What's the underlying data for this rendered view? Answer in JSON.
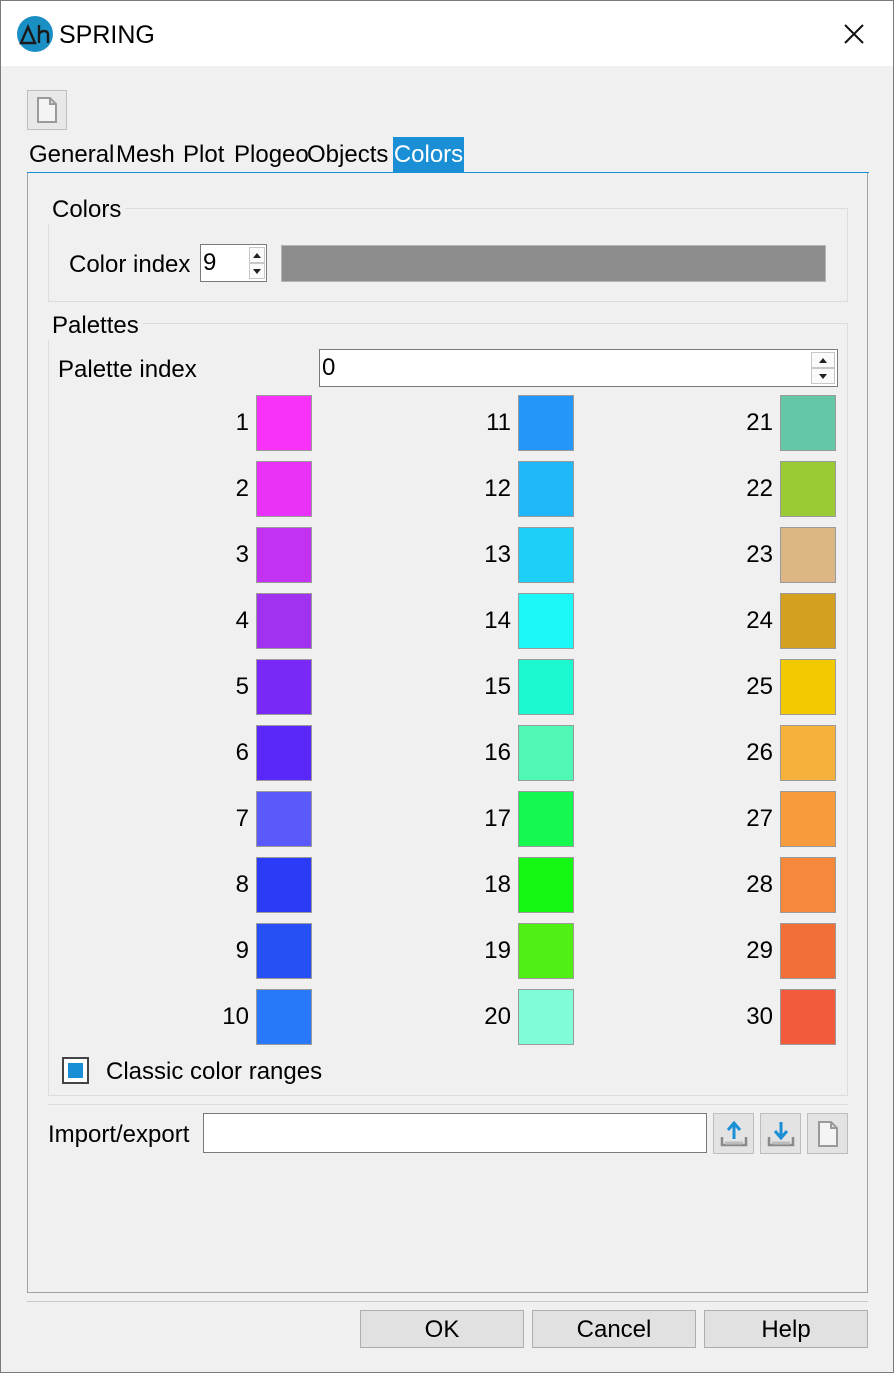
{
  "window": {
    "title": "SPRING",
    "logo_text": "Δh"
  },
  "tabs": [
    {
      "label": "General"
    },
    {
      "label": "Mesh"
    },
    {
      "label": "Plot"
    },
    {
      "label": "Plogeo"
    },
    {
      "label": "Objects"
    },
    {
      "label": "Colors",
      "active": true
    }
  ],
  "colors_group": {
    "title": "Colors",
    "color_index_label": "Color index",
    "color_index_value": "9",
    "preview_color": "#8c8c8c"
  },
  "palettes_group": {
    "title": "Palettes",
    "palette_index_label": "Palette index",
    "palette_index_value": "0",
    "swatches": [
      {
        "n": "1",
        "color": "#f832f8"
      },
      {
        "n": "2",
        "color": "#e832f8"
      },
      {
        "n": "3",
        "color": "#c232f0"
      },
      {
        "n": "4",
        "color": "#a032f0"
      },
      {
        "n": "5",
        "color": "#7a28f8"
      },
      {
        "n": "6",
        "color": "#5a28fa"
      },
      {
        "n": "7",
        "color": "#5a5afa"
      },
      {
        "n": "8",
        "color": "#2a3cf8"
      },
      {
        "n": "9",
        "color": "#2650f6"
      },
      {
        "n": "10",
        "color": "#2878fa"
      },
      {
        "n": "11",
        "color": "#2496fa"
      },
      {
        "n": "12",
        "color": "#20b8f8"
      },
      {
        "n": "13",
        "color": "#1ed0f8"
      },
      {
        "n": "14",
        "color": "#1cf8f8"
      },
      {
        "n": "15",
        "color": "#1cf8d0"
      },
      {
        "n": "16",
        "color": "#50f8b6"
      },
      {
        "n": "17",
        "color": "#14f850"
      },
      {
        "n": "18",
        "color": "#14f814"
      },
      {
        "n": "19",
        "color": "#50f014"
      },
      {
        "n": "20",
        "color": "#80fcd8"
      },
      {
        "n": "21",
        "color": "#64c8a8"
      },
      {
        "n": "22",
        "color": "#9acb34"
      },
      {
        "n": "23",
        "color": "#ddb686"
      },
      {
        "n": "24",
        "color": "#d4a020"
      },
      {
        "n": "25",
        "color": "#f2c800"
      },
      {
        "n": "26",
        "color": "#f6b03c"
      },
      {
        "n": "27",
        "color": "#f69c3c"
      },
      {
        "n": "28",
        "color": "#f6883c"
      },
      {
        "n": "29",
        "color": "#f27038"
      },
      {
        "n": "30",
        "color": "#f45a3c"
      }
    ],
    "classic_ranges_label": "Classic color ranges",
    "classic_ranges_checked": true
  },
  "import_export": {
    "label": "Import/export",
    "value": ""
  },
  "buttons": {
    "ok": "OK",
    "cancel": "Cancel",
    "help": "Help"
  }
}
